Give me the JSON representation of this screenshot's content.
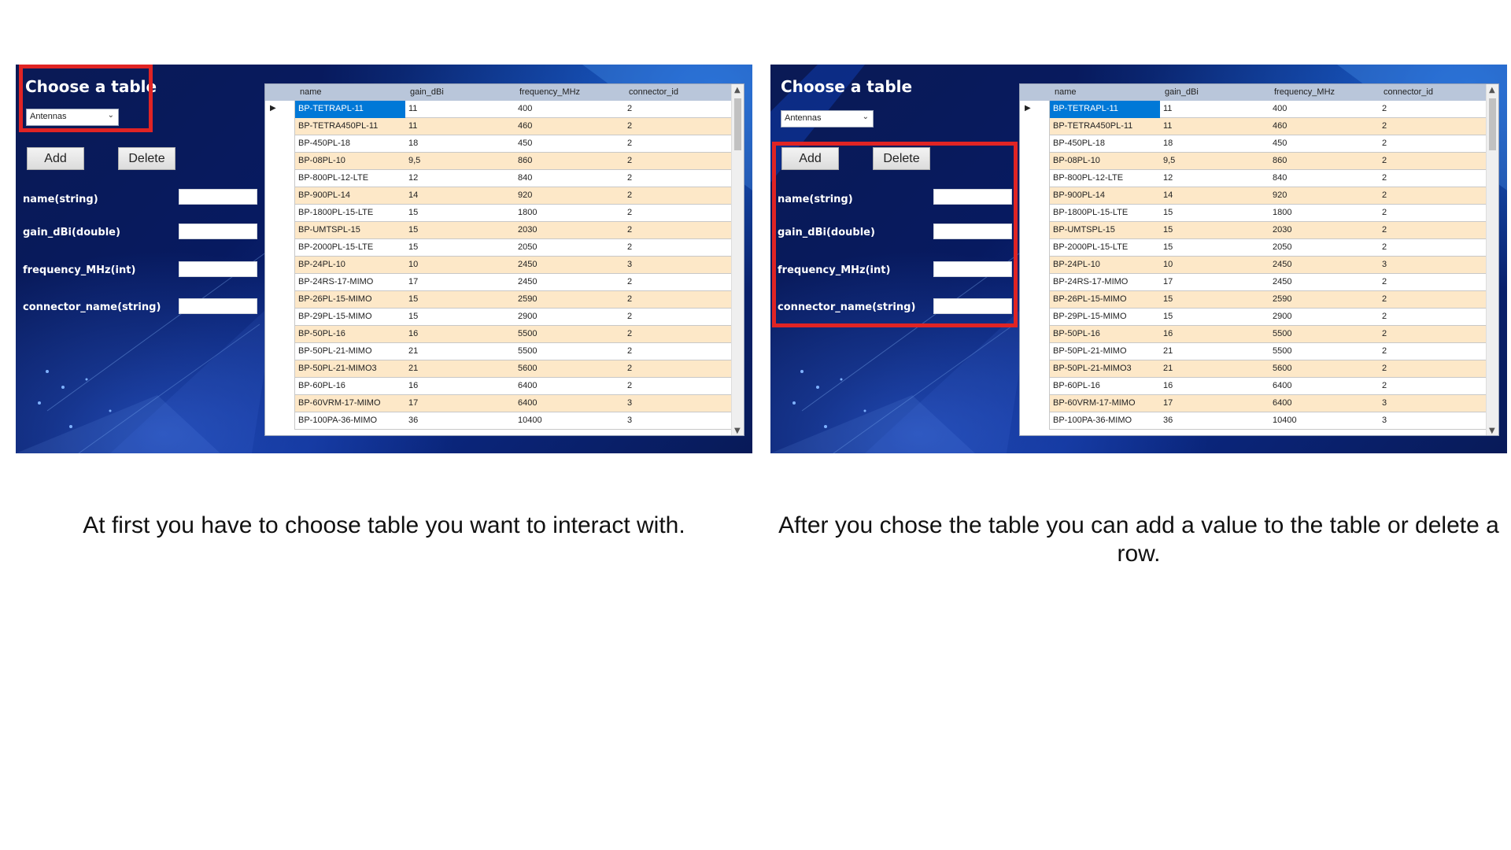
{
  "ui": {
    "choose_title": "Choose a table",
    "selected_table": "Antennas",
    "add_label": "Add",
    "delete_label": "Delete",
    "fields": [
      "name(string)",
      "gain_dBi(double)",
      "frequency_MHz(int)",
      "connector_name(string)"
    ]
  },
  "grid": {
    "columns": [
      "name",
      "gain_dBi",
      "frequency_MHz",
      "connector_id"
    ],
    "rows": [
      [
        "BP-TETRAPL-11",
        "11",
        "400",
        "2"
      ],
      [
        "BP-TETRA450PL-11",
        "11",
        "460",
        "2"
      ],
      [
        "BP-450PL-18",
        "18",
        "450",
        "2"
      ],
      [
        "BP-08PL-10",
        "9,5",
        "860",
        "2"
      ],
      [
        "BP-800PL-12-LTE",
        "12",
        "840",
        "2"
      ],
      [
        "BP-900PL-14",
        "14",
        "920",
        "2"
      ],
      [
        "BP-1800PL-15-LTE",
        "15",
        "1800",
        "2"
      ],
      [
        "BP-UMTSPL-15",
        "15",
        "2030",
        "2"
      ],
      [
        "BP-2000PL-15-LTE",
        "15",
        "2050",
        "2"
      ],
      [
        "BP-24PL-10",
        "10",
        "2450",
        "3"
      ],
      [
        "BP-24RS-17-MIMO",
        "17",
        "2450",
        "2"
      ],
      [
        "BP-26PL-15-MIMO",
        "15",
        "2590",
        "2"
      ],
      [
        "BP-29PL-15-MIMO",
        "15",
        "2900",
        "2"
      ],
      [
        "BP-50PL-16",
        "16",
        "5500",
        "2"
      ],
      [
        "BP-50PL-21-MIMO",
        "21",
        "5500",
        "2"
      ],
      [
        "BP-50PL-21-MIMO3",
        "21",
        "5600",
        "2"
      ],
      [
        "BP-60PL-16",
        "16",
        "6400",
        "2"
      ],
      [
        "BP-60VRM-17-MIMO",
        "17",
        "6400",
        "3"
      ],
      [
        "BP-100PA-36-MIMO",
        "36",
        "10400",
        "3"
      ]
    ]
  },
  "captions": {
    "left": "At first you have to choose table you want to interact with.",
    "right": "After you chose the table you can add a value to the table or delete a row."
  },
  "colors": {
    "highlight": "#e02424",
    "row_alt": "#fde8c8",
    "selection": "#0078d7",
    "header": "#b9c6da"
  }
}
